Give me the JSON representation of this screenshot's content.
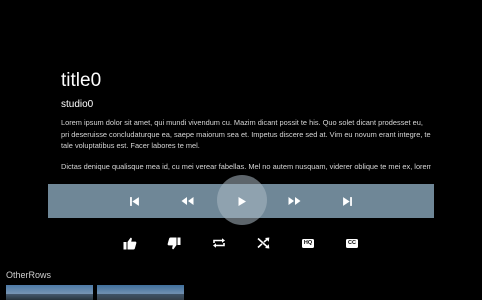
{
  "details": {
    "title": "title0",
    "studio": "studio0",
    "description_1": "Lorem ipsum dolor sit amet, qui mundi vivendum cu. Mazim dicant possit te his. Quo solet dicant prodesset eu, pri deseruisse concludaturque ea, saepe maiorum sea et. Impetus discere sed at. Vim eu novum erant integre, te tale voluptatibus est. Facer labores te mel.",
    "description_2": "Dictas denique qualisque mea id, cu mei verear fabellas. Mel no autem nusquam, viderer oblique te mei ex, lorem ipsum dolor sit amet."
  },
  "transport": {
    "buttons": [
      "skip-previous-icon",
      "rewind-icon",
      "play-icon",
      "fast-forward-icon",
      "skip-next-icon"
    ],
    "bar_color": "#6f8797"
  },
  "secondary": {
    "buttons": [
      "thumbs-up-icon",
      "thumbs-down-icon",
      "repeat-icon",
      "shuffle-icon",
      "hq-icon",
      "closed-captions-icon"
    ],
    "hq_label": "HQ",
    "cc_label": "CC"
  },
  "rows": {
    "header": "OtherRows"
  }
}
